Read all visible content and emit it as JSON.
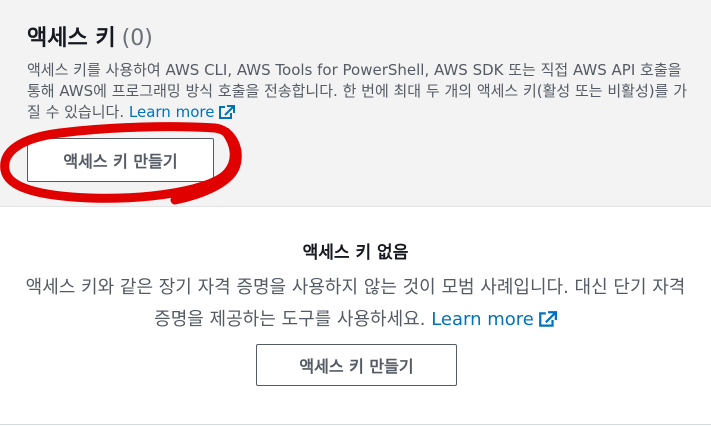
{
  "header": {
    "title": "액세스 키",
    "count": "(0)",
    "description": "액세스 키를 사용하여 AWS CLI, AWS Tools for PowerShell, AWS SDK 또는 직접 AWS API 호출을 통해 AWS에 프로그래밍 방식 호출을 전송합니다. 한 번에 최대 두 개의 액세스 키(활성 또는 비활성)를 가질 수 있습니다.",
    "learn_more": "Learn more",
    "create_button": "액세스 키 만들기"
  },
  "empty_state": {
    "title": "액세스 키 없음",
    "description": "액세스 키와 같은 장기 자격 증명을 사용하지 않는 것이 모범 사례입니다. 대신 단기 자격 증명을 제공하는 도구를 사용하세요.",
    "learn_more": "Learn more",
    "create_button": "액세스 키 만들기"
  },
  "colors": {
    "link": "#0073bb",
    "annotation": "#e00000"
  },
  "icons": {
    "external_link": "external-link-icon"
  }
}
